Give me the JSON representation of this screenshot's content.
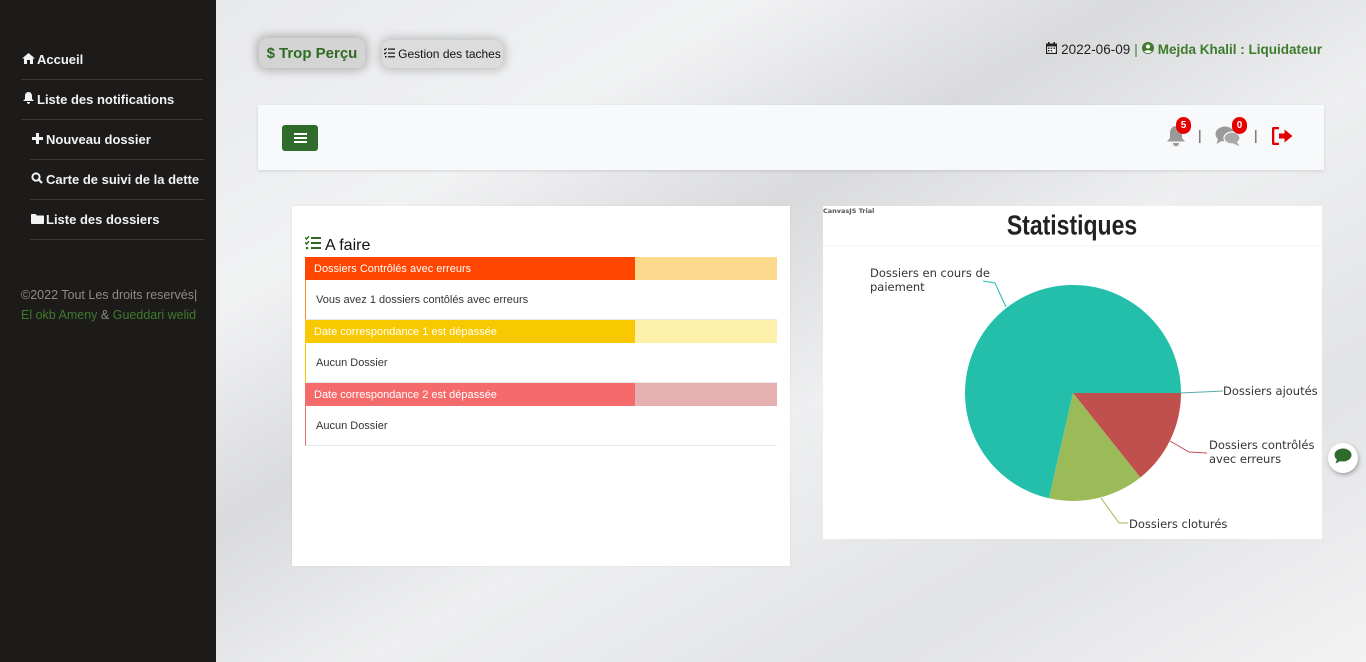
{
  "sidebar": {
    "items": [
      {
        "label": "Accueil",
        "icon": "home-icon"
      },
      {
        "label": "Liste des notifications",
        "icon": "bell-icon"
      },
      {
        "label": "Nouveau dossier",
        "icon": "plus-icon"
      },
      {
        "label": "Carte de suivi de la dette",
        "icon": "search-icon"
      },
      {
        "label": "Liste des dossiers",
        "icon": "folder-icon"
      }
    ],
    "footer": {
      "copyright": "©2022 Tout Les droits reservés|",
      "author1": "El okb Ameny",
      "amp": "&",
      "author2": "Gueddari welid"
    }
  },
  "header": {
    "trop_percu_label": "Trop Perçu",
    "gestion_label": "Gestion des taches",
    "date": "2022-06-09",
    "separator": "|",
    "user": "Mejda Khalil : Liquidateur"
  },
  "navbar": {
    "notifications_count": "5",
    "messages_count": "0",
    "separator": "|"
  },
  "todo": {
    "title": "A faire",
    "tasks": [
      {
        "title": "Dossiers Contrôlés avec erreurs",
        "body": "Vous avez 1 dossiers contôlés avec erreurs",
        "color": "#ff4500",
        "light": "#fcd98c",
        "progress_percent": 70
      },
      {
        "title": "Date correspondance 1 est dépassée",
        "body": "Aucun Dossier",
        "color": "#f8c901",
        "light": "#fdf0a8",
        "progress_percent": 70
      },
      {
        "title": "Date correspondance 2 est dépassée",
        "body": "Aucun Dossier",
        "color": "#f56b6b",
        "light": "#e6b0b0",
        "progress_percent": 70
      }
    ]
  },
  "chart_data": {
    "type": "pie",
    "title": "Statistiques",
    "watermark": "CanvasJS Trial",
    "slices": [
      {
        "label": "Dossiers ajoutés",
        "value": 0,
        "color": "#5aa9a6"
      },
      {
        "label": "Dossiers contrôlés avec erreurs",
        "value": 1,
        "color": "#c0504e"
      },
      {
        "label": "Dossiers cloturés",
        "value": 1,
        "color": "#9bbb58"
      },
      {
        "label": "Dossiers en cours de paiement",
        "value": 5,
        "color": "#23bfaa"
      }
    ],
    "label_lines": [
      [
        "Dossiers en cours de",
        "paiement"
      ],
      [
        "Dossiers ajoutés"
      ],
      [
        "Dossiers contrôlés",
        "avec erreurs"
      ],
      [
        "Dossiers cloturés"
      ]
    ]
  }
}
